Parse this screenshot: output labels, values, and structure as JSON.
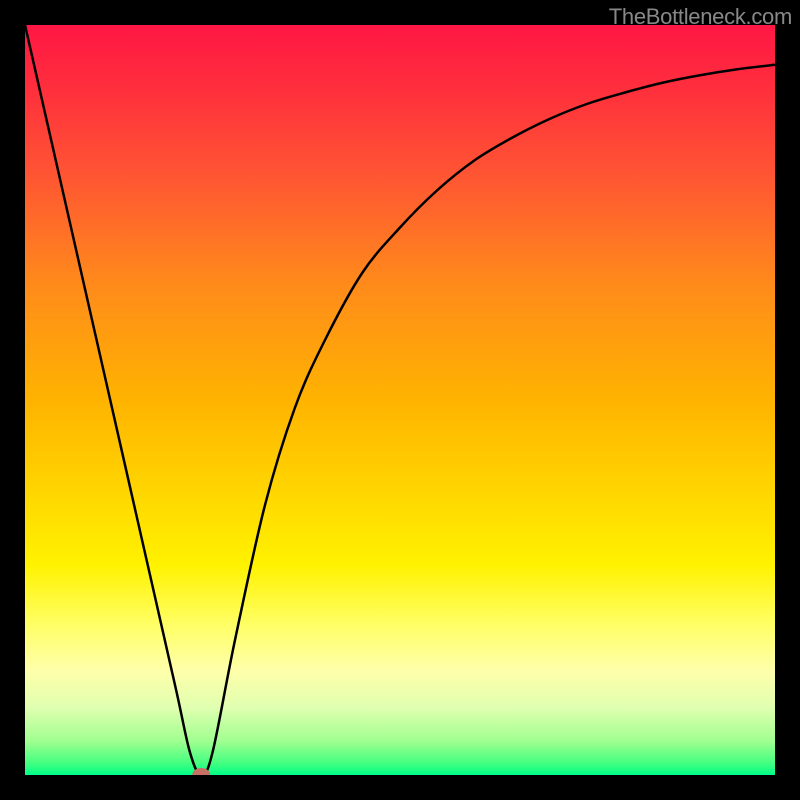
{
  "watermark": "TheBottleneck.com",
  "chart_data": {
    "type": "line",
    "title": "",
    "xlabel": "",
    "ylabel": "",
    "xlim": [
      0,
      100
    ],
    "ylim": [
      0,
      100
    ],
    "background_gradient": {
      "stops": [
        {
          "offset": 0.0,
          "color": "#ff1744"
        },
        {
          "offset": 0.08,
          "color": "#ff2d3d"
        },
        {
          "offset": 0.2,
          "color": "#ff5533"
        },
        {
          "offset": 0.35,
          "color": "#ff8c1a"
        },
        {
          "offset": 0.5,
          "color": "#ffb300"
        },
        {
          "offset": 0.62,
          "color": "#ffd500"
        },
        {
          "offset": 0.72,
          "color": "#fff200"
        },
        {
          "offset": 0.8,
          "color": "#ffff66"
        },
        {
          "offset": 0.86,
          "color": "#ffffaa"
        },
        {
          "offset": 0.91,
          "color": "#e0ffb0"
        },
        {
          "offset": 0.955,
          "color": "#a0ff90"
        },
        {
          "offset": 0.985,
          "color": "#40ff80"
        },
        {
          "offset": 1.0,
          "color": "#00ff88"
        }
      ]
    },
    "series": [
      {
        "name": "curve",
        "color": "#000000",
        "x": [
          0,
          5,
          10,
          15,
          20,
          22,
          23.5,
          25,
          28,
          32,
          36,
          40,
          45,
          50,
          55,
          60,
          65,
          70,
          75,
          80,
          85,
          90,
          95,
          100
        ],
        "y": [
          100,
          78,
          56,
          34,
          12,
          3,
          0,
          3,
          18,
          36,
          49,
          58,
          67,
          73,
          78,
          82,
          85,
          87.5,
          89.5,
          91,
          92.3,
          93.3,
          94.1,
          94.7
        ]
      }
    ],
    "marker": {
      "x": 23.5,
      "y": 0,
      "color": "#c77065",
      "rx": 9,
      "ry": 7
    }
  }
}
